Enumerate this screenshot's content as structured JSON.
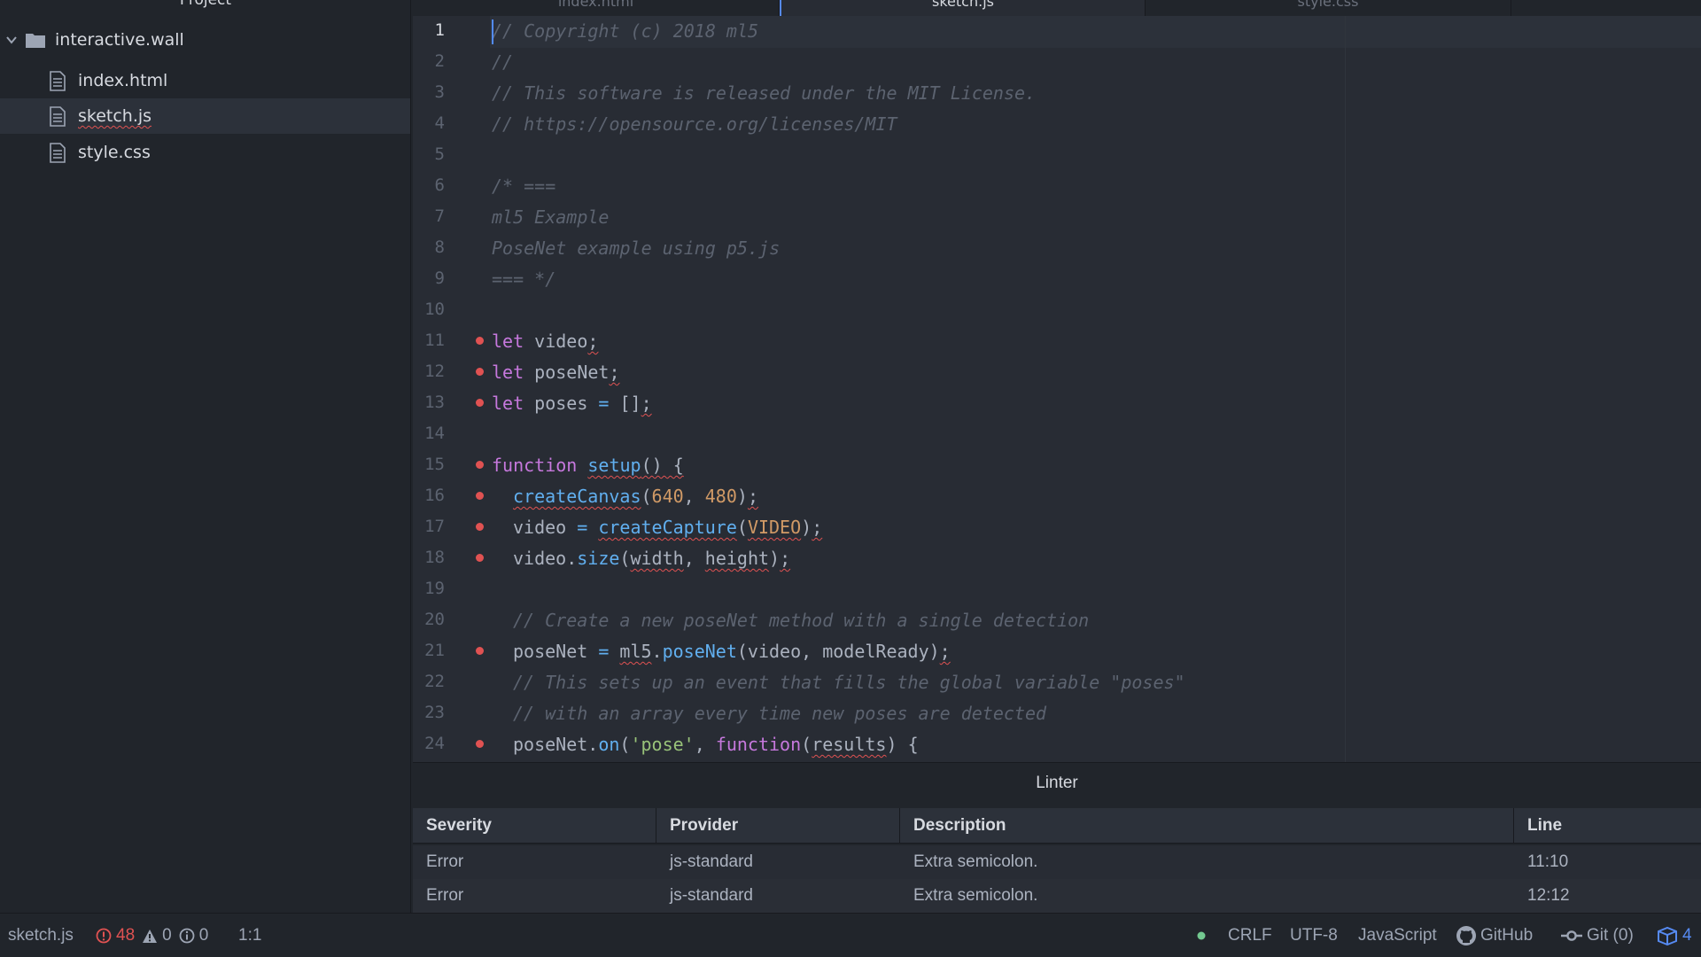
{
  "sidebar": {
    "header": "Project",
    "root_folder": "interactive.wall",
    "files": [
      "index.html",
      "sketch.js",
      "style.css"
    ],
    "selected_file": "sketch.js"
  },
  "tabs": [
    {
      "label": "index.html",
      "active": false
    },
    {
      "label": "sketch.js",
      "active": true
    },
    {
      "label": "style.css",
      "active": false
    }
  ],
  "editor": {
    "lines": [
      {
        "n": "1",
        "tokens": [
          [
            "cm",
            "// Copyright (c) 2018 ml5"
          ]
        ],
        "dot": false,
        "indent": 0
      },
      {
        "n": "2",
        "tokens": [
          [
            "cm",
            "//"
          ]
        ],
        "dot": false,
        "indent": 0
      },
      {
        "n": "3",
        "tokens": [
          [
            "cm",
            "// This software is released under the MIT License."
          ]
        ],
        "dot": false,
        "indent": 0
      },
      {
        "n": "4",
        "tokens": [
          [
            "cm",
            "// https://opensource.org/licenses/MIT"
          ]
        ],
        "dot": false,
        "indent": 0
      },
      {
        "n": "5",
        "tokens": [],
        "dot": false,
        "indent": 0
      },
      {
        "n": "6",
        "tokens": [
          [
            "cm",
            "/* ==="
          ]
        ],
        "dot": false,
        "indent": 0
      },
      {
        "n": "7",
        "tokens": [
          [
            "cm",
            "ml5 Example"
          ]
        ],
        "dot": false,
        "indent": 0
      },
      {
        "n": "8",
        "tokens": [
          [
            "cm",
            "PoseNet example using p5.js"
          ]
        ],
        "dot": false,
        "indent": 0
      },
      {
        "n": "9",
        "tokens": [
          [
            "cm",
            "=== */"
          ]
        ],
        "dot": false,
        "indent": 0
      },
      {
        "n": "10",
        "tokens": [],
        "dot": false,
        "indent": 0
      },
      {
        "n": "11",
        "tokens": [
          [
            "kw",
            "let"
          ],
          [
            "",
            " video"
          ],
          [
            "sq",
            ";"
          ]
        ],
        "dot": true,
        "indent": 0
      },
      {
        "n": "12",
        "tokens": [
          [
            "kw",
            "let"
          ],
          [
            "",
            " poseNet"
          ],
          [
            "sq",
            ";"
          ]
        ],
        "dot": true,
        "indent": 0
      },
      {
        "n": "13",
        "tokens": [
          [
            "kw",
            "let"
          ],
          [
            "",
            " poses "
          ],
          [
            "fn",
            "="
          ],
          [
            "",
            " []"
          ],
          [
            "sq",
            ";"
          ]
        ],
        "dot": true,
        "indent": 0
      },
      {
        "n": "14",
        "tokens": [],
        "dot": false,
        "indent": 0
      },
      {
        "n": "15",
        "tokens": [
          [
            "kw",
            "function"
          ],
          [
            "",
            " "
          ],
          [
            "fn sq",
            "setup"
          ],
          [
            "sq",
            "() {"
          ]
        ],
        "dot": true,
        "indent": 0
      },
      {
        "n": "16",
        "tokens": [
          [
            "fn sq",
            "createCanvas"
          ],
          [
            "",
            "("
          ],
          [
            "nm",
            "640"
          ],
          [
            "",
            ", "
          ],
          [
            "nm",
            "480"
          ],
          [
            "",
            ")"
          ],
          [
            "sq",
            ";"
          ]
        ],
        "dot": true,
        "indent": 1
      },
      {
        "n": "17",
        "tokens": [
          [
            "",
            "video "
          ],
          [
            "fn",
            "="
          ],
          [
            "",
            " "
          ],
          [
            "fn sq",
            "createCapture"
          ],
          [
            "",
            "("
          ],
          [
            "nm sq",
            "VIDEO"
          ],
          [
            "",
            ")"
          ],
          [
            "sq",
            ";"
          ]
        ],
        "dot": true,
        "indent": 1
      },
      {
        "n": "18",
        "tokens": [
          [
            "",
            "video."
          ],
          [
            "fn",
            "size"
          ],
          [
            "",
            "("
          ],
          [
            "sq",
            "width"
          ],
          [
            "",
            ", "
          ],
          [
            "sq",
            "height"
          ],
          [
            "",
            ")"
          ],
          [
            "sq",
            ";"
          ]
        ],
        "dot": true,
        "indent": 1
      },
      {
        "n": "19",
        "tokens": [],
        "dot": false,
        "indent": 0
      },
      {
        "n": "20",
        "tokens": [
          [
            "cm",
            "// Create a new poseNet method with a single detection"
          ]
        ],
        "dot": false,
        "indent": 1
      },
      {
        "n": "21",
        "tokens": [
          [
            "",
            "poseNet "
          ],
          [
            "fn",
            "="
          ],
          [
            "",
            " "
          ],
          [
            "sq",
            "ml5"
          ],
          [
            "",
            "."
          ],
          [
            "fn",
            "poseNet"
          ],
          [
            "",
            "(video, modelReady)"
          ],
          [
            "sq",
            ";"
          ]
        ],
        "dot": true,
        "indent": 1
      },
      {
        "n": "22",
        "tokens": [
          [
            "cm",
            "// This sets up an event that fills the global variable \"poses\""
          ]
        ],
        "dot": false,
        "indent": 1
      },
      {
        "n": "23",
        "tokens": [
          [
            "cm",
            "// with an array every time new poses are detected"
          ]
        ],
        "dot": false,
        "indent": 1
      },
      {
        "n": "24",
        "tokens": [
          [
            "",
            "poseNet."
          ],
          [
            "fn",
            "on"
          ],
          [
            "",
            "("
          ],
          [
            "st",
            "'pose'"
          ],
          [
            "",
            ", "
          ],
          [
            "kw",
            "function"
          ],
          [
            "",
            "("
          ],
          [
            "sq",
            "results"
          ],
          [
            "",
            ") {"
          ]
        ],
        "dot": true,
        "indent": 1
      }
    ]
  },
  "linter": {
    "title": "Linter",
    "columns": [
      "Severity",
      "Provider",
      "Description",
      "Line"
    ],
    "rows": [
      [
        "Error",
        "js-standard",
        "Extra semicolon.",
        "11:10"
      ],
      [
        "Error",
        "js-standard",
        "Extra semicolon.",
        "12:12"
      ]
    ]
  },
  "status": {
    "file": "sketch.js",
    "errors": "48",
    "warnings": "0",
    "infos": "0",
    "cursor": "1:1",
    "line_ending": "CRLF",
    "encoding": "UTF-8",
    "grammar": "JavaScript",
    "github": "GitHub",
    "git": "Git (0)",
    "packages": "4"
  },
  "colors": {
    "accent": "#568af2",
    "error": "#e05252",
    "ok": "#73c990"
  }
}
